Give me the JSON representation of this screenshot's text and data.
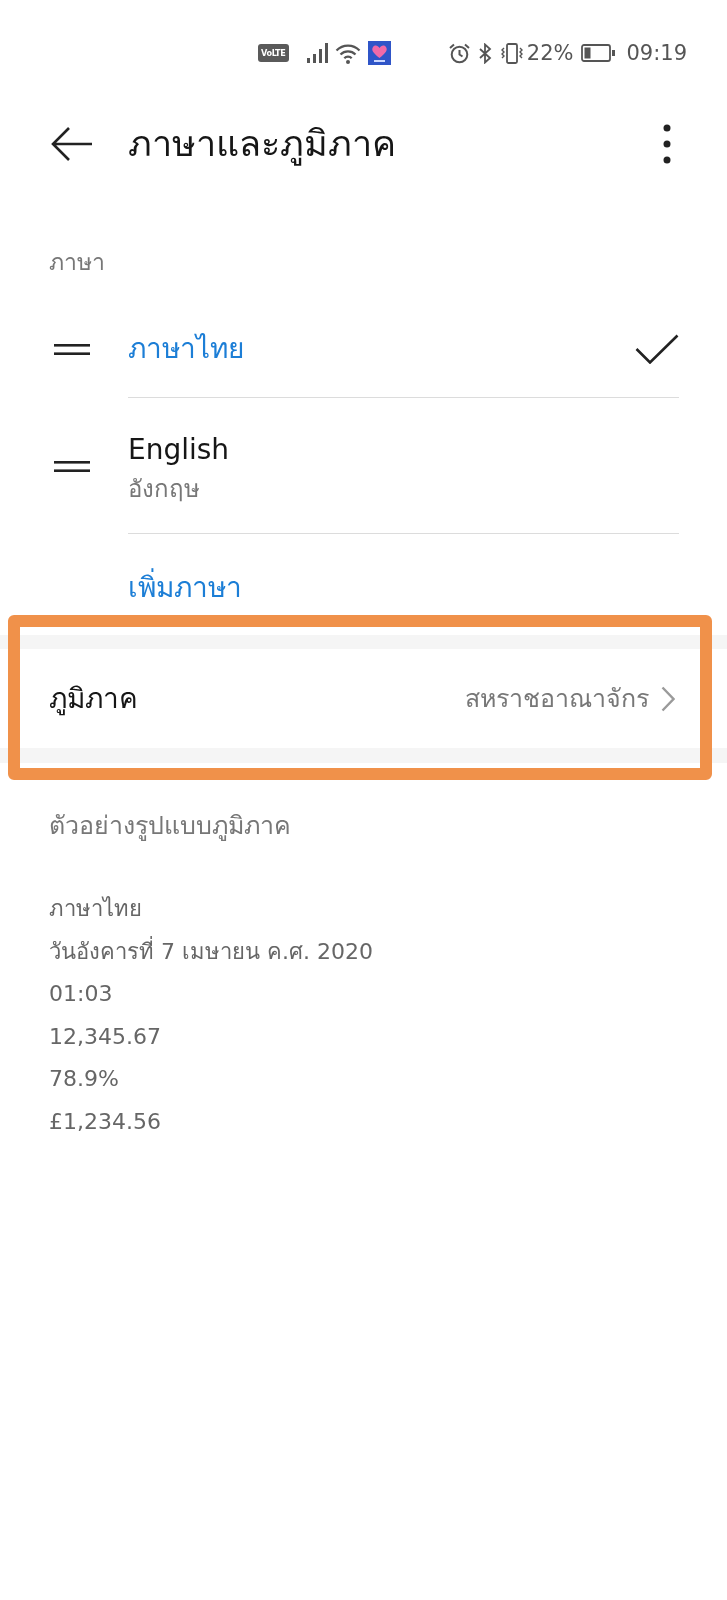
{
  "status_bar": {
    "network_badge": "VoLTE",
    "battery_percent": "22%",
    "time": "09:19"
  },
  "app_bar": {
    "title": "ภาษาและภูมิภาค"
  },
  "languages": {
    "heading": "ภาษา",
    "items": [
      {
        "name": "ภาษาไทย",
        "selected": true
      },
      {
        "name": "English",
        "native_name": "อังกฤษ",
        "selected": false
      }
    ],
    "add_action": "เพิ่มภาษา"
  },
  "region": {
    "label": "ภูมิภาค",
    "value": "สหราชอาณาจักร",
    "highlighted": true
  },
  "format_example": {
    "heading": "ตัวอย่างรูปแบบภูมิภาค",
    "lines": [
      "ภาษาไทย",
      "วันอังคารที่ 7 เมษายน ค.ศ. 2020",
      "01:03",
      "12,345.67",
      "78.9%",
      "£1,234.56"
    ]
  }
}
